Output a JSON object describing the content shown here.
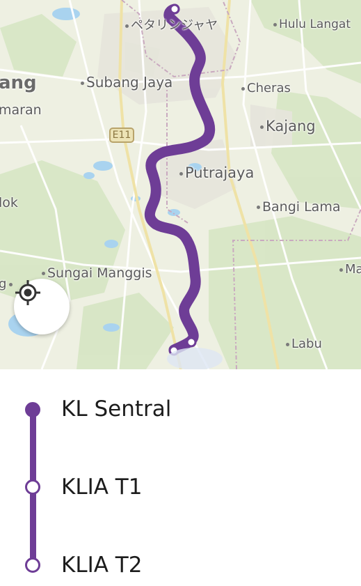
{
  "map": {
    "route_color": "#6e3d96",
    "road_shield": "E11",
    "places": [
      {
        "name": "ペタリンジャヤ",
        "id": "petaling-jaya"
      },
      {
        "name": "Hulu Langat",
        "id": "hulu-langat"
      },
      {
        "name": "ang",
        "id": "klang-partial"
      },
      {
        "name": "Subang Jaya",
        "id": "subang-jaya"
      },
      {
        "name": "Cheras",
        "id": "cheras"
      },
      {
        "name": "maran",
        "id": "semenyih-partial"
      },
      {
        "name": "Kajang",
        "id": "kajang"
      },
      {
        "name": "Putrajaya",
        "id": "putrajaya"
      },
      {
        "name": "lok",
        "id": "lok-partial"
      },
      {
        "name": "Bangi Lama",
        "id": "bangi-lama"
      },
      {
        "name": "Ma",
        "id": "ma-partial"
      },
      {
        "name": "Sungai Manggis",
        "id": "sungai-manggis"
      },
      {
        "name": "g",
        "id": "g-partial"
      },
      {
        "name": "Labu",
        "id": "labu"
      }
    ]
  },
  "locate_button": {
    "icon": "locate-crosshair-icon"
  },
  "stops": [
    {
      "label": "KL Sentral",
      "type": "filled"
    },
    {
      "label": "KLIA T1",
      "type": "hollow"
    },
    {
      "label": "KLIA T2",
      "type": "hollow"
    }
  ]
}
